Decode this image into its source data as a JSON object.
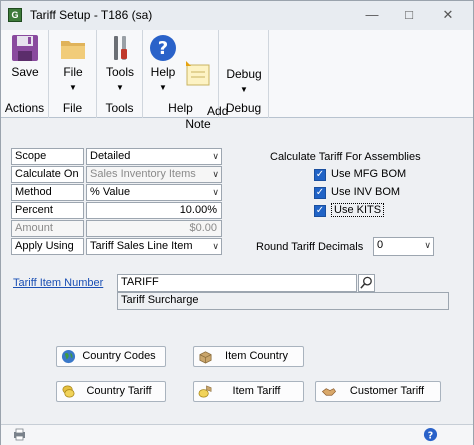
{
  "window": {
    "title": "Tariff Setup  -  T186 (sa)"
  },
  "ribbon": {
    "actions": {
      "save_label": "Save",
      "group_label": "Actions"
    },
    "file": {
      "file_label": "File",
      "group_label": "File"
    },
    "tools": {
      "tools_label": "Tools",
      "group_label": "Tools"
    },
    "help": {
      "help_label": "Help",
      "add_note_label": "Add\nNote",
      "group_label": "Help"
    },
    "debug": {
      "debug_label": "Debug",
      "group_label": "Debug"
    }
  },
  "form": {
    "scope": {
      "label": "Scope",
      "value": "Detailed"
    },
    "calculate_on": {
      "label": "Calculate On",
      "value": "Sales Inventory Items"
    },
    "method": {
      "label": "Method",
      "value": "% Value"
    },
    "percent": {
      "label": "Percent",
      "value": "10.00%"
    },
    "amount": {
      "label": "Amount",
      "value": "$0.00"
    },
    "apply_using": {
      "label": "Apply Using",
      "value": "Tariff Sales Line Item"
    },
    "assemblies": {
      "heading": "Calculate Tariff For Assemblies",
      "mfg_bom": {
        "label": "Use MFG BOM",
        "checked": true
      },
      "inv_bom": {
        "label": "Use INV BOM",
        "checked": true
      },
      "kits": {
        "label": "Use KITS",
        "checked": true
      }
    },
    "round_decimals": {
      "label": "Round Tariff Decimals",
      "value": "0"
    },
    "tariff_item": {
      "label": "Tariff Item Number",
      "value": "TARIFF",
      "description": "Tariff Surcharge"
    }
  },
  "buttons": {
    "country_codes": "Country Codes",
    "item_country": "Item Country",
    "country_tariff": "Country Tariff",
    "item_tariff": "Item Tariff",
    "customer_tariff": "Customer Tariff"
  },
  "colors": {
    "accent": "#2063c6",
    "link": "#1a4fb4"
  }
}
